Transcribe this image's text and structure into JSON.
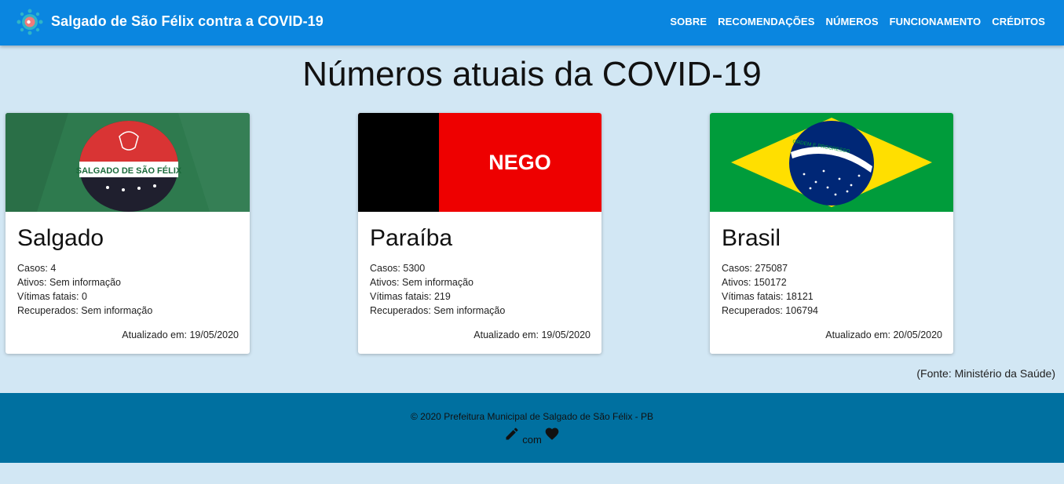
{
  "header": {
    "brand": "Salgado de São Félix contra a COVID-19",
    "nav": [
      "SOBRE",
      "RECOMENDAÇÕES",
      "NÚMEROS",
      "FUNCIONAMENTO",
      "CRÉDITOS"
    ]
  },
  "main": {
    "title": "Números atuais da COVID-19",
    "cards": [
      {
        "name": "Salgado",
        "flag_text": "SALGADO DE SÃO FÉLIX",
        "cases": "Casos: 4",
        "active": "Ativos: Sem informação",
        "deaths": "Vítimas fatais: 0",
        "recovered": "Recuperados: Sem informação",
        "updated": "Atualizado em: 19/05/2020"
      },
      {
        "name": "Paraíba",
        "flag_text": "NEGO",
        "cases": "Casos: 5300",
        "active": "Ativos: Sem informação",
        "deaths": "Vítimas fatais: 219",
        "recovered": "Recuperados: Sem informação",
        "updated": "Atualizado em: 19/05/2020"
      },
      {
        "name": "Brasil",
        "flag_text": "ORDEM E PROGRESSO",
        "cases": "Casos: 275087",
        "active": "Ativos: 150172",
        "deaths": "Vítimas fatais: 18121",
        "recovered": "Recuperados: 106794",
        "updated": "Atualizado em: 20/05/2020"
      }
    ],
    "source": "(Fonte: Ministério da Saúde)"
  },
  "footer": {
    "copyright": "© 2020 Prefeitura Municipal de Salgado de São Félix - PB",
    "made_with": "com"
  },
  "colors": {
    "header": "#0a86e0",
    "background": "#d2e7f4",
    "footer": "#0070a0"
  },
  "icons": [
    "virus-logo-icon",
    "pencil-icon",
    "heart-icon"
  ]
}
